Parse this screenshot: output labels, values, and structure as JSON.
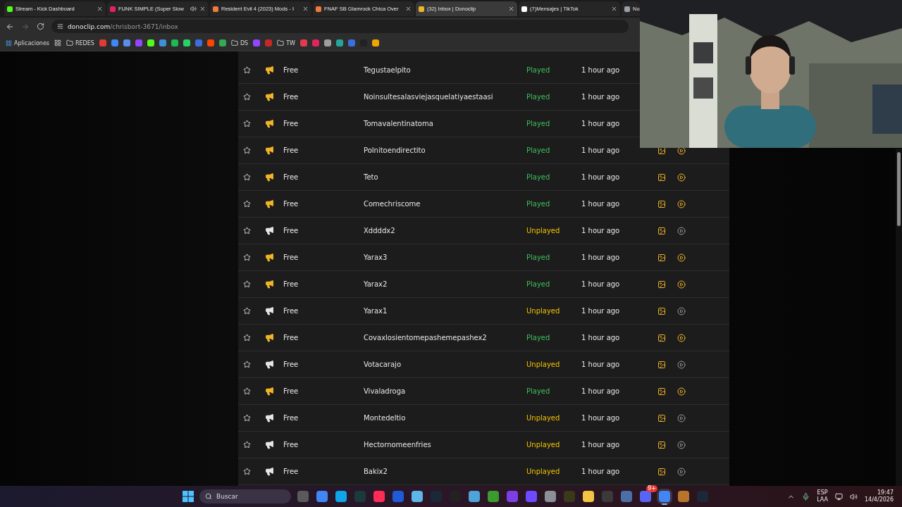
{
  "browser": {
    "tabs": [
      {
        "title": "Stream - Kick Dashboard",
        "selected": false,
        "audio": false,
        "color": "#53fc18"
      },
      {
        "title": "FUNK SIMPLE (Super Slow",
        "selected": false,
        "audio": true,
        "color": "#e0245e"
      },
      {
        "title": "Resident Evil 4 (2023) Mods - I",
        "selected": false,
        "audio": false,
        "color": "#f07a3c"
      },
      {
        "title": "FNAF SB Glamrock Chica Over",
        "selected": false,
        "audio": false,
        "color": "#f07a3c"
      },
      {
        "title": "(32) Inbox | Donoclip",
        "selected": true,
        "audio": false,
        "color": "#f0b429"
      },
      {
        "title": "(7)Mensajes | TikTok",
        "selected": false,
        "audio": false,
        "color": "#ffffff"
      },
      {
        "title": "Nu",
        "selected": false,
        "color": "#9aa0a6"
      }
    ],
    "address": {
      "domain": "donoclip.com",
      "path": "/chrisbort-3671/inbox"
    },
    "bookmarks": [
      {
        "kind": "apps",
        "label": "Aplicaciones"
      },
      {
        "kind": "grid"
      },
      {
        "kind": "folder",
        "label": "REDES"
      },
      {
        "kind": "site",
        "color": "#e53935"
      },
      {
        "kind": "site",
        "color": "#4285f4"
      },
      {
        "kind": "site",
        "color": "#5b8def"
      },
      {
        "kind": "site",
        "color": "#9146ff"
      },
      {
        "kind": "site",
        "color": "#53fc18"
      },
      {
        "kind": "site",
        "color": "#3f8fd8"
      },
      {
        "kind": "site",
        "color": "#1db954"
      },
      {
        "kind": "site",
        "color": "#25d366"
      },
      {
        "kind": "site",
        "color": "#3b6fe0"
      },
      {
        "kind": "site",
        "color": "#ff4500"
      },
      {
        "kind": "site",
        "color": "#34a853"
      },
      {
        "kind": "folder",
        "label": "DS"
      },
      {
        "kind": "site",
        "color": "#9146ff"
      },
      {
        "kind": "site",
        "color": "#c62828"
      },
      {
        "kind": "folder",
        "label": "TW"
      },
      {
        "kind": "site",
        "color": "#e53950"
      },
      {
        "kind": "site",
        "color": "#e0245e"
      },
      {
        "kind": "site",
        "color": "#9e9e9e"
      },
      {
        "kind": "site",
        "color": "#26a69a"
      },
      {
        "kind": "site",
        "color": "#3b6fe0"
      },
      {
        "kind": "site",
        "color": "#222222"
      },
      {
        "kind": "site",
        "color": "#f0a500"
      }
    ]
  },
  "inbox": {
    "rows": [
      {
        "tier": "Free",
        "name": "Tegustaelpito",
        "status": "Played",
        "played": true,
        "time": "1 hour ago"
      },
      {
        "tier": "Free",
        "name": "Noinsultesalasviejasquelatiyaestaasi",
        "status": "Played",
        "played": true,
        "time": "1 hour ago"
      },
      {
        "tier": "Free",
        "name": "Tomavalentinatoma",
        "status": "Played",
        "played": true,
        "time": "1 hour ago"
      },
      {
        "tier": "Free",
        "name": "Polnitoendirectito",
        "status": "Played",
        "played": true,
        "time": "1 hour ago"
      },
      {
        "tier": "Free",
        "name": "Teto",
        "status": "Played",
        "played": true,
        "time": "1 hour ago"
      },
      {
        "tier": "Free",
        "name": "Comechriscome",
        "status": "Played",
        "played": true,
        "time": "1 hour ago"
      },
      {
        "tier": "Free",
        "name": "Xddddx2",
        "status": "Unplayed",
        "played": false,
        "time": "1 hour ago"
      },
      {
        "tier": "Free",
        "name": "Yarax3",
        "status": "Played",
        "played": true,
        "time": "1 hour ago"
      },
      {
        "tier": "Free",
        "name": "Yarax2",
        "status": "Played",
        "played": true,
        "time": "1 hour ago"
      },
      {
        "tier": "Free",
        "name": "Yarax1",
        "status": "Unplayed",
        "played": false,
        "time": "1 hour ago"
      },
      {
        "tier": "Free",
        "name": "Covaxlosientomepashemepashex2",
        "status": "Played",
        "played": true,
        "time": "1 hour ago"
      },
      {
        "tier": "Free",
        "name": "Votacarajo",
        "status": "Unplayed",
        "played": false,
        "time": "1 hour ago"
      },
      {
        "tier": "Free",
        "name": "Vivaladroga",
        "status": "Played",
        "played": true,
        "time": "1 hour ago"
      },
      {
        "tier": "Free",
        "name": "Montedeltio",
        "status": "Unplayed",
        "played": false,
        "time": "1 hour ago"
      },
      {
        "tier": "Free",
        "name": "Hectornomeenfries",
        "status": "Unplayed",
        "played": false,
        "time": "1 hour ago"
      },
      {
        "tier": "Free",
        "name": "Bakix2",
        "status": "Unplayed",
        "played": false,
        "time": "1 hour ago"
      }
    ]
  },
  "taskbar": {
    "search": {
      "placeholder": "Buscar"
    },
    "apps": [
      {
        "color": "#5a5a5a",
        "selected": false
      },
      {
        "color": "#4285f4",
        "selected": false
      },
      {
        "color": "#0ea5e9",
        "selected": false
      },
      {
        "color": "#1b3a3a",
        "selected": false
      },
      {
        "color": "#fe2c55",
        "selected": false
      },
      {
        "color": "#1e5bd8",
        "selected": false
      },
      {
        "color": "#5fb4e8",
        "selected": false
      },
      {
        "color": "#1b2838",
        "selected": false
      },
      {
        "color": "#222222",
        "selected": false
      },
      {
        "color": "#4fa3d9",
        "selected": false
      },
      {
        "color": "#3c9b2f",
        "selected": false
      },
      {
        "color": "#7b3fe4",
        "selected": false
      },
      {
        "color": "#6d4aff",
        "selected": false
      },
      {
        "color": "#8a8f98",
        "selected": false
      },
      {
        "color": "#3a3a1a",
        "selected": false
      },
      {
        "color": "#f4c542",
        "selected": false
      },
      {
        "color": "#3a3a3a",
        "selected": false
      },
      {
        "color": "#4a6fa5",
        "selected": false
      },
      {
        "color": "#5865f2",
        "selected": false,
        "badge": "9+"
      },
      {
        "color": "#4285f4",
        "selected": true
      },
      {
        "color": "#b8742a",
        "selected": false
      },
      {
        "color": "#1b2838",
        "selected": false
      }
    ],
    "tray": {
      "language": "ESP",
      "region": "LAA",
      "time": "19:47",
      "date": "14/4/2026"
    }
  }
}
